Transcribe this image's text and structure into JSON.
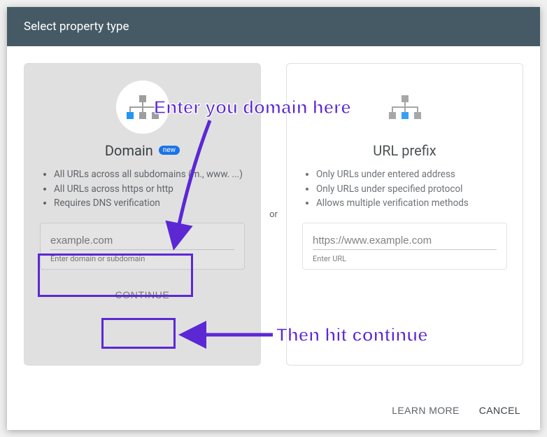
{
  "dialog": {
    "title": "Select property type"
  },
  "separator": "or",
  "domain_card": {
    "title": "Domain",
    "badge": "new",
    "bullets": [
      "All URLs across all subdomains (m., www. ...)",
      "All URLs across https or http",
      "Requires DNS verification"
    ],
    "input_placeholder": "example.com",
    "input_helper": "Enter domain or subdomain",
    "button": "CONTINUE"
  },
  "urlprefix_card": {
    "title": "URL prefix",
    "bullets": [
      "Only URLs under entered address",
      "Only URLs under specified protocol",
      "Allows multiple verification methods"
    ],
    "input_placeholder": "https://www.example.com",
    "input_helper": "Enter URL"
  },
  "footer": {
    "learn": "LEARN MORE",
    "cancel": "CANCEL"
  },
  "annotations": {
    "label1": "Enter you domain here",
    "label2": "Then hit continue"
  }
}
